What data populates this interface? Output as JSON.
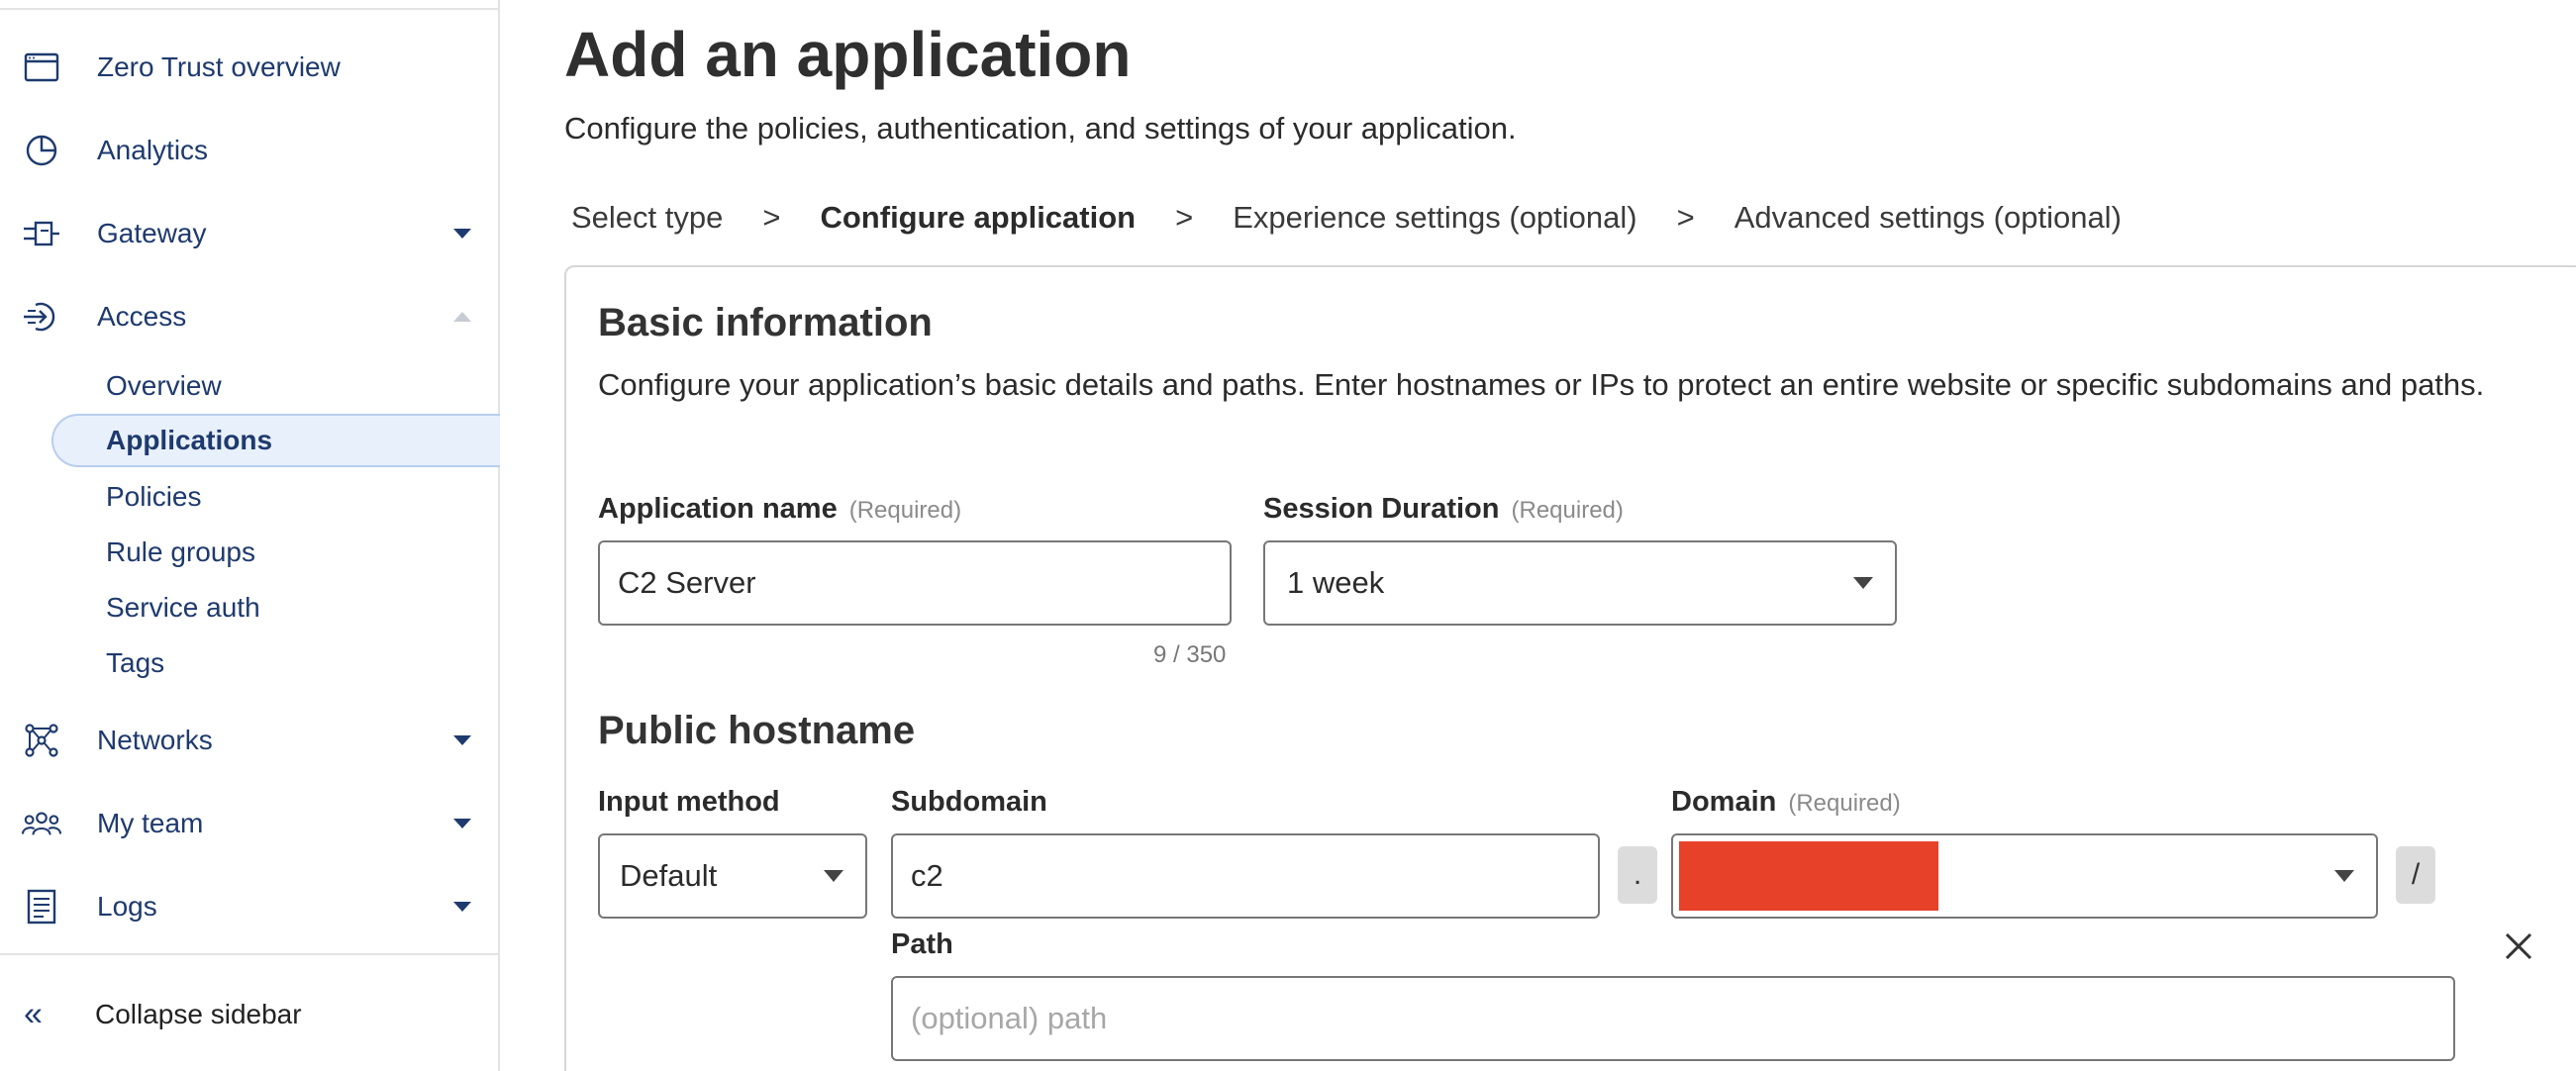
{
  "sidebar": {
    "items": [
      {
        "label": "Zero Trust overview",
        "icon": "browser-window-icon"
      },
      {
        "label": "Analytics",
        "icon": "pie-chart-icon"
      },
      {
        "label": "Gateway",
        "icon": "gateway-icon"
      },
      {
        "label": "Access",
        "icon": "access-icon"
      }
    ],
    "access_sub": [
      {
        "label": "Overview"
      },
      {
        "label": "Applications"
      },
      {
        "label": "Policies"
      },
      {
        "label": "Rule groups"
      },
      {
        "label": "Service auth"
      },
      {
        "label": "Tags"
      }
    ],
    "more_items": [
      {
        "label": "Networks",
        "icon": "network-icon"
      },
      {
        "label": "My team",
        "icon": "team-icon"
      },
      {
        "label": "Logs",
        "icon": "logs-icon"
      }
    ],
    "collapse_label": "Collapse sidebar",
    "collapse_icon": "«"
  },
  "page": {
    "title": "Add an application",
    "subtitle": "Configure the policies, authentication, and settings of your application."
  },
  "steps": {
    "items": [
      "Select type",
      "Configure application",
      "Experience settings (optional)",
      "Advanced settings (optional)"
    ],
    "separator": ">",
    "current_index": 1
  },
  "basic": {
    "title": "Basic information",
    "description": "Configure your application’s basic details and paths. Enter hostnames or IPs to protect an entire website or specific subdomains and paths.",
    "app_name_label": "Application name",
    "app_name_required": "(Required)",
    "app_name_value": "C2 Server",
    "app_name_counter": "9 / 350",
    "session_label": "Session Duration",
    "session_required": "(Required)",
    "session_value": "1 week"
  },
  "hostname": {
    "title": "Public hostname",
    "input_method_label": "Input method",
    "input_method_value": "Default",
    "subdomain_label": "Subdomain",
    "subdomain_value": "c2",
    "dot": ".",
    "domain_label": "Domain",
    "domain_required": "(Required)",
    "slash": "/",
    "path_label": "Path",
    "path_placeholder": "(optional) path"
  },
  "colors": {
    "nav_text": "#1e3a6e",
    "active_bg": "#e8f0fc",
    "redaction": "#e8412a"
  }
}
